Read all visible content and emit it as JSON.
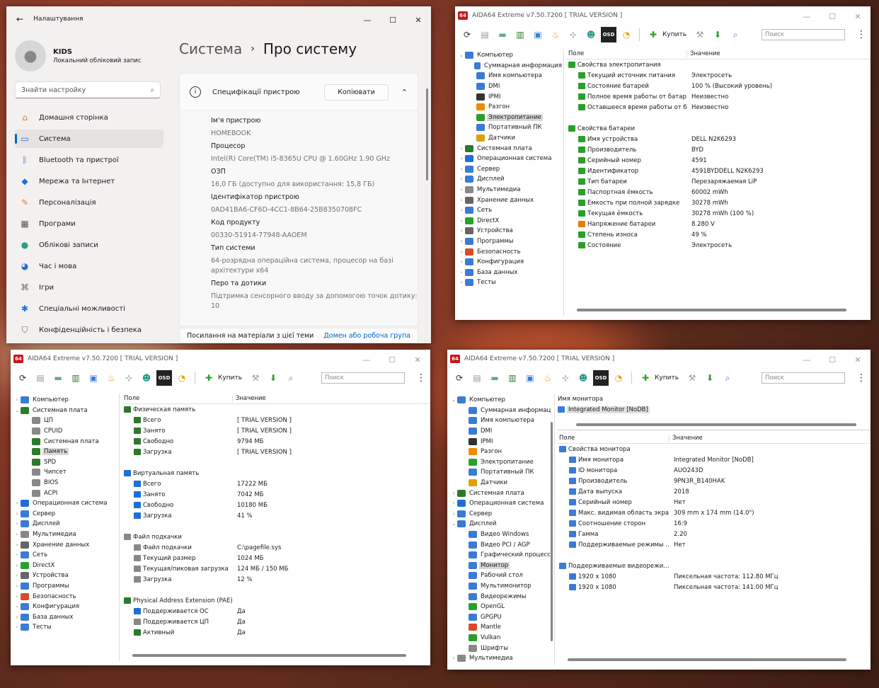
{
  "settings": {
    "title": "Налаштування",
    "user_name": "KIDS",
    "user_sub": "Локальний обліковий запис",
    "search_placeholder": "Знайти настройку",
    "nav": [
      {
        "label": "Домашня сторінка",
        "icon": "home-icon"
      },
      {
        "label": "Система",
        "icon": "system-icon"
      },
      {
        "label": "Bluetooth та пристрої",
        "icon": "bluetooth-icon"
      },
      {
        "label": "Мережа та Інтернет",
        "icon": "wifi-icon"
      },
      {
        "label": "Персоналізація",
        "icon": "brush-icon"
      },
      {
        "label": "Програми",
        "icon": "apps-icon"
      },
      {
        "label": "Облікові записи",
        "icon": "account-icon"
      },
      {
        "label": "Час і мова",
        "icon": "globe-icon"
      },
      {
        "label": "Ігри",
        "icon": "gamepad-icon"
      },
      {
        "label": "Спеціальні можливості",
        "icon": "accessibility-icon"
      },
      {
        "label": "Конфіденційність і безпека",
        "icon": "shield-icon"
      }
    ],
    "bc_parent": "Система",
    "bc_current": "Про систему",
    "spec_title": "Специфікації пристрою",
    "copy_label": "Копіювати",
    "specs": [
      {
        "label": "Ім'я пристрою",
        "value": "HOMEBOOK"
      },
      {
        "label": "Процесор",
        "value": "Intel(R) Core(TM) i5-8365U CPU @ 1.60GHz   1.90 GHz"
      },
      {
        "label": "ОЗП",
        "value": "16,0 ГБ (доступно для використання: 15,8 ГБ)"
      },
      {
        "label": "Ідентифікатор пристрою",
        "value": "0AD41BA6-CF6D-4CC1-8B64-25B8350708FC"
      },
      {
        "label": "Код продукту",
        "value": "00330-51914-77948-AAOEM"
      },
      {
        "label": "Тип системи",
        "value": "64-розрядна операційна система, процесор на базі архітектури x64"
      },
      {
        "label": "Перо та дотики",
        "value": "Підтримка сенсорного вводу за допомогою точок дотику: 10"
      }
    ],
    "links_label": "Посилання на матеріали з цієї теми",
    "link_domain": "Домен або робоча група"
  },
  "aida": {
    "title": "AIDA64 Extreme v7.50.7200  [ TRIAL VERSION ]",
    "buy": "Купить",
    "search": "Поиск",
    "col_field": "Поле",
    "col_value": "Значение"
  },
  "win_tr": {
    "tree": [
      {
        "label": "Компьютер",
        "d": 0,
        "exp": "⌄",
        "c": "#3a7bd5"
      },
      {
        "label": "Суммарная информация",
        "d": 1,
        "c": "#3a7bd5"
      },
      {
        "label": "Имя компьютера",
        "d": 1,
        "c": "#3a7bd5"
      },
      {
        "label": "DMI",
        "d": 1,
        "c": "#3a7bd5"
      },
      {
        "label": "IPMI",
        "d": 1,
        "c": "#333"
      },
      {
        "label": "Разгон",
        "d": 1,
        "c": "#f08a00"
      },
      {
        "label": "Электропитание",
        "d": 1,
        "c": "#2aa02a",
        "sel": true
      },
      {
        "label": "Портативный ПК",
        "d": 1,
        "c": "#3a7bd5"
      },
      {
        "label": "Датчики",
        "d": 1,
        "c": "#e0a000"
      },
      {
        "label": "Системная плата",
        "d": 0,
        "exp": "›",
        "c": "#2a7a2a"
      },
      {
        "label": "Операционная система",
        "d": 0,
        "exp": "›",
        "c": "#1e6fd9"
      },
      {
        "label": "Сервер",
        "d": 0,
        "exp": "›",
        "c": "#3a7bd5"
      },
      {
        "label": "Дисплей",
        "d": 0,
        "exp": "›",
        "c": "#3a7bd5"
      },
      {
        "label": "Мультимедиа",
        "d": 0,
        "exp": "›",
        "c": "#888"
      },
      {
        "label": "Хранение данных",
        "d": 0,
        "exp": "›",
        "c": "#666"
      },
      {
        "label": "Сеть",
        "d": 0,
        "exp": "›",
        "c": "#3a7bd5"
      },
      {
        "label": "DirectX",
        "d": 0,
        "exp": "›",
        "c": "#2aa02a"
      },
      {
        "label": "Устройства",
        "d": 0,
        "exp": "›",
        "c": "#666"
      },
      {
        "label": "Программы",
        "d": 0,
        "exp": "›",
        "c": "#3a7bd5"
      },
      {
        "label": "Безопасность",
        "d": 0,
        "exp": "›",
        "c": "#d94a2a"
      },
      {
        "label": "Конфигурация",
        "d": 0,
        "exp": "›",
        "c": "#3a7bd5"
      },
      {
        "label": "База данных",
        "d": 0,
        "exp": "›",
        "c": "#3a7bd5"
      },
      {
        "label": "Тесты",
        "d": 0,
        "exp": "›",
        "c": "#3a7bd5"
      }
    ],
    "rows": [
      {
        "f": "Свойства электропитания",
        "v": "",
        "h": true,
        "c": "#2aa02a"
      },
      {
        "f": "Текущий источник питания",
        "v": "Электросеть",
        "c": "#2aa02a"
      },
      {
        "f": "Состояние батарей",
        "v": "100 % (Высокий уровень)",
        "c": "#2aa02a"
      },
      {
        "f": "Полное время работы от батар...",
        "v": "Неизвестно",
        "c": "#2aa02a"
      },
      {
        "f": "Оставшееся время работы от б...",
        "v": "Неизвестно",
        "c": "#2aa02a"
      },
      {
        "f": "",
        "v": "",
        "gap": true
      },
      {
        "f": "Свойства батареи",
        "v": "",
        "h": true,
        "c": "#2aa02a"
      },
      {
        "f": "Имя устройства",
        "v": "DELL N2K6293",
        "c": "#2aa02a"
      },
      {
        "f": "Производитель",
        "v": "BYD",
        "c": "#2aa02a"
      },
      {
        "f": "Серийный номер",
        "v": "4591",
        "c": "#2aa02a"
      },
      {
        "f": "Идентификатор",
        "v": "4591BYDDELL N2K6293",
        "c": "#2aa02a"
      },
      {
        "f": "Тип батареи",
        "v": "Перезаряжаемая LiP",
        "c": "#2aa02a"
      },
      {
        "f": "Паспортная ёмкость",
        "v": "60002 mWh",
        "c": "#2aa02a"
      },
      {
        "f": "Ёмкость при полной зарядке",
        "v": "30278 mWh",
        "c": "#2aa02a"
      },
      {
        "f": "Текущая ёмкость",
        "v": "30278 mWh  (100 %)",
        "c": "#2aa02a"
      },
      {
        "f": "Напряжение батареи",
        "v": "8.280 V",
        "c": "#e08000"
      },
      {
        "f": "Степень износа",
        "v": "49 %",
        "c": "#2aa02a"
      },
      {
        "f": "Состояние",
        "v": "Электросеть",
        "c": "#2aa02a"
      }
    ]
  },
  "win_bl": {
    "tree": [
      {
        "label": "Компьютер",
        "d": 0,
        "exp": "›",
        "c": "#3a7bd5"
      },
      {
        "label": "Системная плата",
        "d": 0,
        "exp": "⌄",
        "c": "#2a7a2a"
      },
      {
        "label": "ЦП",
        "d": 1,
        "c": "#888"
      },
      {
        "label": "CPUID",
        "d": 1,
        "c": "#888"
      },
      {
        "label": "Системная плата",
        "d": 1,
        "c": "#2a7a2a"
      },
      {
        "label": "Память",
        "d": 1,
        "c": "#2a7a2a",
        "sel": true
      },
      {
        "label": "SPD",
        "d": 1,
        "c": "#2a7a2a"
      },
      {
        "label": "Чипсет",
        "d": 1,
        "c": "#888"
      },
      {
        "label": "BIOS",
        "d": 1,
        "c": "#888"
      },
      {
        "label": "ACPI",
        "d": 1,
        "c": "#888"
      },
      {
        "label": "Операционная система",
        "d": 0,
        "exp": "›",
        "c": "#1e6fd9"
      },
      {
        "label": "Сервер",
        "d": 0,
        "exp": "›",
        "c": "#3a7bd5"
      },
      {
        "label": "Дисплей",
        "d": 0,
        "exp": "›",
        "c": "#3a7bd5"
      },
      {
        "label": "Мультимедиа",
        "d": 0,
        "exp": "›",
        "c": "#888"
      },
      {
        "label": "Хранение данных",
        "d": 0,
        "exp": "›",
        "c": "#666"
      },
      {
        "label": "Сеть",
        "d": 0,
        "exp": "›",
        "c": "#3a7bd5"
      },
      {
        "label": "DirectX",
        "d": 0,
        "exp": "›",
        "c": "#2aa02a"
      },
      {
        "label": "Устройства",
        "d": 0,
        "exp": "›",
        "c": "#666"
      },
      {
        "label": "Программы",
        "d": 0,
        "exp": "›",
        "c": "#3a7bd5"
      },
      {
        "label": "Безопасность",
        "d": 0,
        "exp": "›",
        "c": "#d94a2a"
      },
      {
        "label": "Конфигурация",
        "d": 0,
        "exp": "›",
        "c": "#3a7bd5"
      },
      {
        "label": "База данных",
        "d": 0,
        "exp": "›",
        "c": "#3a7bd5"
      },
      {
        "label": "Тесты",
        "d": 0,
        "exp": "›",
        "c": "#3a7bd5"
      }
    ],
    "rows": [
      {
        "f": "Физическая память",
        "v": "",
        "h": true,
        "c": "#2a7a2a"
      },
      {
        "f": "Всего",
        "v": "[ TRIAL VERSION ]",
        "c": "#2a7a2a"
      },
      {
        "f": "Занято",
        "v": "[ TRIAL VERSION ]",
        "c": "#2a7a2a"
      },
      {
        "f": "Свободно",
        "v": "9794 МБ",
        "c": "#2a7a2a"
      },
      {
        "f": "Загрузка",
        "v": "[ TRIAL VERSION ]",
        "c": "#2a7a2a"
      },
      {
        "f": "",
        "v": "",
        "gap": true
      },
      {
        "f": "Виртуальная память",
        "v": "",
        "h": true,
        "c": "#1e6fd9"
      },
      {
        "f": "Всего",
        "v": "17222 МБ",
        "c": "#1e6fd9"
      },
      {
        "f": "Занято",
        "v": "7042 МБ",
        "c": "#1e6fd9"
      },
      {
        "f": "Свободно",
        "v": "10180 МБ",
        "c": "#1e6fd9"
      },
      {
        "f": "Загрузка",
        "v": "41 %",
        "c": "#1e6fd9"
      },
      {
        "f": "",
        "v": "",
        "gap": true
      },
      {
        "f": "Файл подкачки",
        "v": "",
        "h": true,
        "c": "#888"
      },
      {
        "f": "Файл подкачки",
        "v": "C:\\pagefile.sys",
        "c": "#888"
      },
      {
        "f": "Текущий размер",
        "v": "1024 МБ",
        "c": "#888"
      },
      {
        "f": "Текущая/пиковая загрузка",
        "v": "124 МБ / 150 МБ",
        "c": "#888"
      },
      {
        "f": "Загрузка",
        "v": "12 %",
        "c": "#888"
      },
      {
        "f": "",
        "v": "",
        "gap": true
      },
      {
        "f": "Physical Address Extension (PAE)",
        "v": "",
        "h": true,
        "c": "#2a7a2a"
      },
      {
        "f": "Поддерживается ОС",
        "v": "Да",
        "c": "#1e6fd9"
      },
      {
        "f": "Поддерживается ЦП",
        "v": "Да",
        "c": "#888"
      },
      {
        "f": "Активный",
        "v": "Да",
        "c": "#2a7a2a"
      }
    ]
  },
  "win_br": {
    "tree": [
      {
        "label": "Компьютер",
        "d": 0,
        "exp": "⌄",
        "c": "#3a7bd5"
      },
      {
        "label": "Суммарная информац",
        "d": 1,
        "c": "#3a7bd5"
      },
      {
        "label": "Имя компьютера",
        "d": 1,
        "c": "#3a7bd5"
      },
      {
        "label": "DMI",
        "d": 1,
        "c": "#3a7bd5"
      },
      {
        "label": "IPMI",
        "d": 1,
        "c": "#333"
      },
      {
        "label": "Разгон",
        "d": 1,
        "c": "#f08a00"
      },
      {
        "label": "Электропитание",
        "d": 1,
        "c": "#2aa02a"
      },
      {
        "label": "Портативный ПК",
        "d": 1,
        "c": "#3a7bd5"
      },
      {
        "label": "Датчики",
        "d": 1,
        "c": "#e0a000"
      },
      {
        "label": "Системная плата",
        "d": 0,
        "exp": "›",
        "c": "#2a7a2a"
      },
      {
        "label": "Операционная система",
        "d": 0,
        "exp": "›",
        "c": "#1e6fd9"
      },
      {
        "label": "Сервер",
        "d": 0,
        "exp": "›",
        "c": "#3a7bd5"
      },
      {
        "label": "Дисплей",
        "d": 0,
        "exp": "⌄",
        "c": "#3a7bd5"
      },
      {
        "label": "Видео Windows",
        "d": 1,
        "c": "#3a7bd5"
      },
      {
        "label": "Видео PCI / AGP",
        "d": 1,
        "c": "#3a7bd5"
      },
      {
        "label": "Графический процесс",
        "d": 1,
        "c": "#3a7bd5"
      },
      {
        "label": "Монитор",
        "d": 1,
        "c": "#3a7bd5",
        "sel": true
      },
      {
        "label": "Рабочий стол",
        "d": 1,
        "c": "#3a7bd5"
      },
      {
        "label": "Мультимонитор",
        "d": 1,
        "c": "#3a7bd5"
      },
      {
        "label": "Видеорежимы",
        "d": 1,
        "c": "#3a7bd5"
      },
      {
        "label": "OpenGL",
        "d": 1,
        "c": "#2aa02a"
      },
      {
        "label": "GPGPU",
        "d": 1,
        "c": "#3a7bd5"
      },
      {
        "label": "Mantle",
        "d": 1,
        "c": "#d94a2a"
      },
      {
        "label": "Vulkan",
        "d": 1,
        "c": "#2aa02a"
      },
      {
        "label": "Шрифты",
        "d": 1,
        "c": "#888"
      },
      {
        "label": "Мультимедиа",
        "d": 0,
        "exp": "›",
        "c": "#888"
      }
    ],
    "top_col": "Имя монитора",
    "top_item": "Integrated Monitor [NoDB]",
    "rows": [
      {
        "f": "Свойства монитора",
        "v": "",
        "h": true,
        "c": "#3a7bd5"
      },
      {
        "f": "Имя монитора",
        "v": "Integrated Monitor [NoDB]",
        "c": "#3a7bd5"
      },
      {
        "f": "ID монитора",
        "v": "AUO243D",
        "c": "#3a7bd5"
      },
      {
        "f": "Производитель",
        "v": "9PN3R_B140HAK",
        "c": "#3a7bd5"
      },
      {
        "f": "Дата выпуска",
        "v": "2018",
        "c": "#3a7bd5"
      },
      {
        "f": "Серийный номер",
        "v": "Нет",
        "c": "#3a7bd5"
      },
      {
        "f": "Макс. видимая область экра...",
        "v": "309 mm x 174 mm (14.0\")",
        "c": "#3a7bd5"
      },
      {
        "f": "Соотношение сторон",
        "v": "16:9",
        "c": "#3a7bd5"
      },
      {
        "f": "Гамма",
        "v": "2.20",
        "c": "#3a7bd5"
      },
      {
        "f": "Поддерживаемые режимы ...",
        "v": "Нет",
        "c": "#3a7bd5"
      },
      {
        "f": "",
        "v": "",
        "gap": true
      },
      {
        "f": "Поддерживаемые видеорежи...",
        "v": "",
        "h": true,
        "c": "#3a7bd5"
      },
      {
        "f": "1920 x 1080",
        "v": "Пиксельная частота: 112.80 МГц",
        "c": "#3a7bd5"
      },
      {
        "f": "1920 x 1080",
        "v": "Пиксельная частота: 141.00 МГц",
        "c": "#3a7bd5"
      }
    ]
  }
}
